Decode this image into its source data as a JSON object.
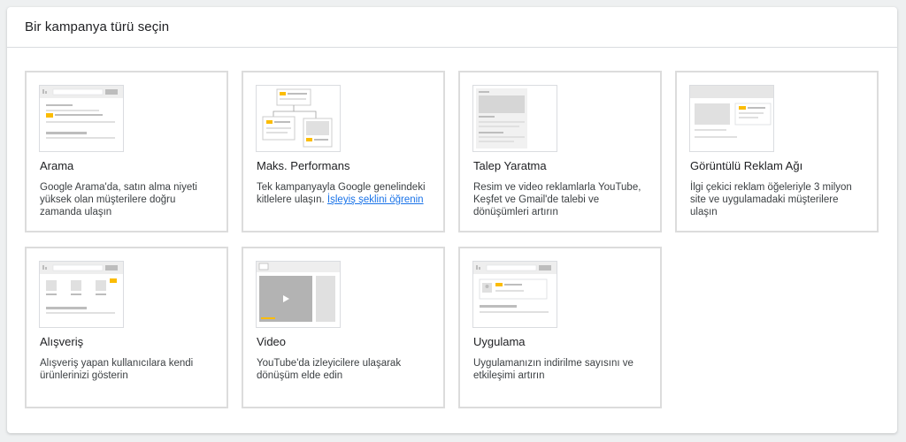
{
  "header": {
    "title": "Bir kampanya türü seçin"
  },
  "cards": [
    {
      "name": "Arama",
      "description": "Google Arama'da, satın alma niyeti yüksek olan müşterilere doğru zamanda ulaşın",
      "illustration": "search-ad-illustration"
    },
    {
      "name": "Maks. Performans",
      "description": "Tek kampanyayla Google genelindeki kitlelere ulaşın.",
      "link": "İşleyiş şeklini öğrenin",
      "illustration": "performance-max-illustration"
    },
    {
      "name": "Talep Yaratma",
      "description": "Resim ve video reklamlarla YouTube, Keşfet ve Gmail'de talebi ve dönüşümleri artırın",
      "illustration": "demand-gen-illustration"
    },
    {
      "name": "Görüntülü Reklam Ağı",
      "description": "İlgi çekici reklam öğeleriyle 3 milyon site ve uygulamadaki müşterilere ulaşın",
      "illustration": "display-network-illustration"
    },
    {
      "name": "Alışveriş",
      "description": "Alışveriş yapan kullanıcılara kendi ürünlerinizi gösterin",
      "illustration": "shopping-illustration"
    },
    {
      "name": "Video",
      "description": "YouTube'da izleyicilere ulaşarak dönüşüm elde edin",
      "illustration": "video-illustration"
    },
    {
      "name": "Uygulama",
      "description": "Uygulamanızın indirilme sayısını ve etkileşimi artırın",
      "illustration": "app-illustration"
    }
  ],
  "colors": {
    "accent": "#fbbc04",
    "link": "#1a73e8",
    "card_border": "#dcdcdc",
    "illustration_gray": "#dadce0"
  }
}
